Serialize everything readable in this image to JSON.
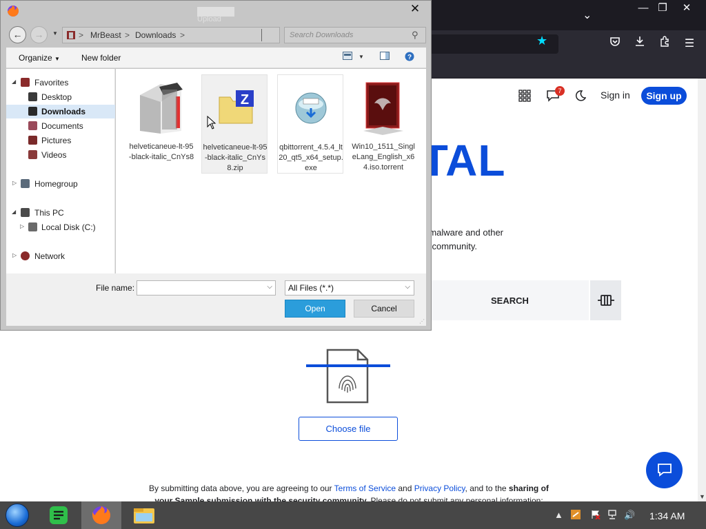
{
  "browser": {
    "window_controls": {
      "minimize": "—",
      "maximize": "❐",
      "close": "✕"
    },
    "toolbar_icons": [
      "pocket-icon",
      "download-icon",
      "extensions-icon",
      "menu-icon"
    ]
  },
  "page": {
    "header": {
      "notification_count": "7",
      "sign_in": "Sign in",
      "sign_up": "Sign up"
    },
    "logo_fragment": "OTAL",
    "description_line1": "malware and other",
    "description_line2": "community.",
    "search_label": "SEARCH",
    "choose_file": "Choose file",
    "terms": {
      "prefix": "By submitting data above, you are agreeing to our ",
      "tos": "Terms of Service",
      "and": " and ",
      "privacy": "Privacy Policy",
      "middle": ", and to the ",
      "bold1": "sharing of",
      "line2_bold": "your Sample submission with the security community.",
      "line2_rest": " Please do not submit any personal information;"
    }
  },
  "dialog": {
    "title": "File Upload",
    "breadcrumbs": [
      "MrBeast",
      "Downloads"
    ],
    "search_placeholder": "Search Downloads",
    "organize": "Organize",
    "new_folder": "New folder",
    "nav": {
      "favorites": "Favorites",
      "desktop": "Desktop",
      "downloads": "Downloads",
      "documents": "Documents",
      "pictures": "Pictures",
      "videos": "Videos",
      "homegroup": "Homegroup",
      "this_pc": "This PC",
      "local_disk": "Local Disk (C:)",
      "network": "Network"
    },
    "files": [
      {
        "name": "helveticaneue-lt-95-black-italic_CnYs8"
      },
      {
        "name": "helveticaneue-lt-95-black-italic_CnYs8.zip"
      },
      {
        "name": "qbittorrent_4.5.4_lt20_qt5_x64_setup.exe"
      },
      {
        "name": "Win10_1511_SingleLang_English_x64.iso.torrent"
      }
    ],
    "file_name_label": "File name:",
    "file_name_value": "",
    "file_type": "All Files (*.*)",
    "open": "Open",
    "cancel": "Cancel"
  },
  "taskbar": {
    "clock": "1:34 AM"
  },
  "colors": {
    "accent": "#0b4dda",
    "open_button": "#2b9ddb",
    "taskbar": "#474747"
  }
}
